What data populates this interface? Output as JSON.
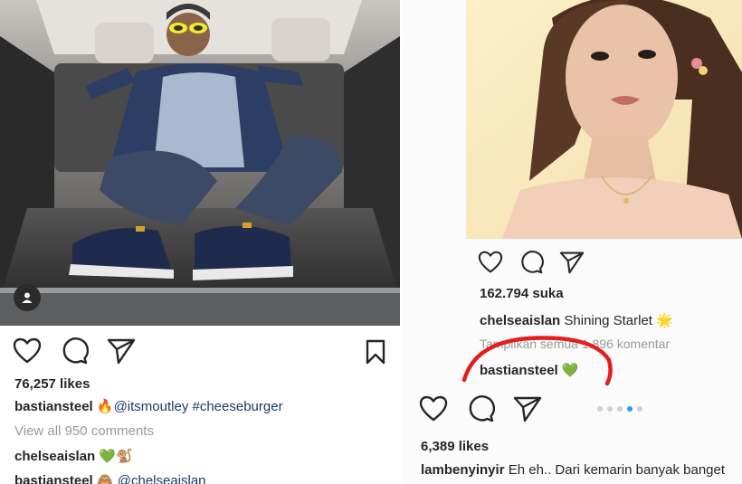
{
  "colors": {
    "accent_link": "#1a3a6b",
    "muted_text": "#9a9a9a",
    "carousel_active": "#3897f0",
    "annotation_red": "#e0201f",
    "heart_green": "#2db84b"
  },
  "left_post": {
    "photo_icon": "person-tag-icon",
    "actions": {
      "like_icon": "heart-icon",
      "comment_icon": "comment-icon",
      "share_icon": "send-icon",
      "save_icon": "bookmark-icon"
    },
    "likes": "76,257 likes",
    "caption": {
      "username": "bastiansteel",
      "emoji": "🔥",
      "mention": "@itsmoutley",
      "hashtag": "#cheeseburger"
    },
    "view_comments": "View all 950 comments",
    "comments": [
      {
        "username": "chelseaislan",
        "text": "💚🐒"
      },
      {
        "username": "bastiansteel",
        "emoji": "🙈",
        "text": "@chelseaislan"
      }
    ]
  },
  "right_post": {
    "actions": {
      "like_icon": "heart-icon",
      "comment_icon": "comment-icon",
      "share_icon": "send-icon"
    },
    "likes": "162.794 suka",
    "caption": {
      "username": "chelseaislan",
      "text": "Shining Starlet",
      "emoji": "🌟"
    },
    "view_comments": "Tampilkan semua 1.896 komentar",
    "comment": {
      "username": "bastiansteel",
      "text": "💚"
    }
  },
  "repost": {
    "actions": {
      "like_icon": "heart-icon",
      "comment_icon": "comment-icon",
      "share_icon": "send-icon"
    },
    "carousel": {
      "count": 5,
      "active_index": 3
    },
    "likes": "6,389 likes",
    "caption": {
      "username": "lambenyinyir",
      "text": "Eh eh.. Dari kemarin banyak banget"
    }
  }
}
